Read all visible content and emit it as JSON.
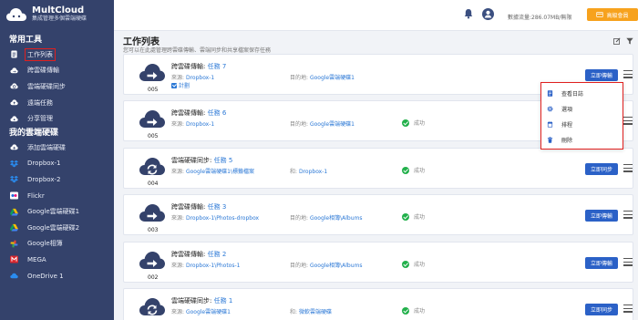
{
  "app": {
    "name": "MultCloud",
    "subtitle": "集成管理多個雲端硬碟"
  },
  "sidebar": {
    "section_tools": "常用工具",
    "tools": [
      {
        "label": "工作列表",
        "icon": "task-list-icon",
        "active": true
      },
      {
        "label": "跨雲碟傳輸",
        "icon": "cloud-transfer-icon"
      },
      {
        "label": "雲端硬碟同步",
        "icon": "cloud-sync-icon"
      },
      {
        "label": "遠端任務",
        "icon": "remote-upload-icon"
      },
      {
        "label": "分享管理",
        "icon": "share-icon"
      }
    ],
    "section_clouds": "我的雲端硬碟",
    "clouds": [
      {
        "label": "添加雲端硬碟",
        "icon": "add-cloud-icon"
      },
      {
        "label": "Dropbox-1",
        "icon": "dropbox-icon"
      },
      {
        "label": "Dropbox-2",
        "icon": "dropbox-icon"
      },
      {
        "label": "Flickr",
        "icon": "flickr-icon"
      },
      {
        "label": "Google雲端硬碟1",
        "icon": "google-drive-icon"
      },
      {
        "label": "Google雲端硬碟2",
        "icon": "google-drive-icon"
      },
      {
        "label": "Google相簿",
        "icon": "google-photos-icon"
      },
      {
        "label": "MEGA",
        "icon": "mega-icon"
      },
      {
        "label": "OneDrive 1",
        "icon": "onedrive-icon"
      }
    ]
  },
  "topbar": {
    "traffic": "數據流量:286.07MB/無限",
    "upgrade": "高級會員"
  },
  "page": {
    "title": "工作列表",
    "description": "您可以在此處管理跨雲碟傳輸、雲端同步和共享檔案保存任務"
  },
  "labels": {
    "source": "來源:",
    "dest": "目的地:",
    "and": "和:",
    "schedule": "計劃",
    "success": "成功",
    "run_transfer": "立即傳輸",
    "run_sync": "立即同步"
  },
  "tasks": [
    {
      "type": "跨雲碟傳輸:",
      "name": "任務 7",
      "num": "005",
      "source": "Dropbox-1",
      "dest_label": "目的地:",
      "dest": "Google雲端硬碟1",
      "kind": "transfer",
      "status": "",
      "scheduled": true,
      "button": "立即傳輸"
    },
    {
      "type": "跨雲碟傳輸:",
      "name": "任務 6",
      "num": "005",
      "source": "Dropbox-1",
      "dest_label": "目的地:",
      "dest": "Google雲端硬碟1",
      "kind": "transfer",
      "status": "成功",
      "scheduled": false,
      "button": ""
    },
    {
      "type": "雲端硬碟同步:",
      "name": "任務 5",
      "num": "004",
      "source": "Google雲端硬碟1\\標籤檔案",
      "dest_label": "和:",
      "dest": "Dropbox-1",
      "kind": "sync",
      "status": "成功",
      "scheduled": false,
      "button": "立即同步"
    },
    {
      "type": "跨雲碟傳輸:",
      "name": "任務 3",
      "num": "003",
      "source": "Dropbox-1\\Photos-dropbox",
      "dest_label": "目的地:",
      "dest": "Google相簿\\Albums",
      "kind": "transfer",
      "status": "成功",
      "scheduled": false,
      "button": "立即傳輸"
    },
    {
      "type": "跨雲碟傳輸:",
      "name": "任務 2",
      "num": "002",
      "source": "Dropbox-1\\Photos-1",
      "dest_label": "目的地:",
      "dest": "Google相簿\\Albums",
      "kind": "transfer",
      "status": "成功",
      "scheduled": false,
      "button": "立即傳輸"
    },
    {
      "type": "雲端硬碟同步:",
      "name": "任務 1",
      "num": "",
      "source": "Google雲端硬碟1",
      "dest_label": "和:",
      "dest": "微軟雲端硬碟",
      "kind": "sync",
      "status": "成功",
      "scheduled": false,
      "button": "立即同步"
    }
  ],
  "dropdown": {
    "items": [
      {
        "label": "查看日誌",
        "icon": "log-icon"
      },
      {
        "label": "選項",
        "icon": "gear-icon"
      },
      {
        "label": "排程",
        "icon": "schedule-icon"
      },
      {
        "label": "刪除",
        "icon": "trash-icon"
      }
    ]
  },
  "colors": {
    "sidebar": "#34426b",
    "accent": "#2b61c7",
    "link": "#2b78d6",
    "success": "#22b04b",
    "upgrade": "#f7a21d",
    "highlight": "#e0201f"
  }
}
